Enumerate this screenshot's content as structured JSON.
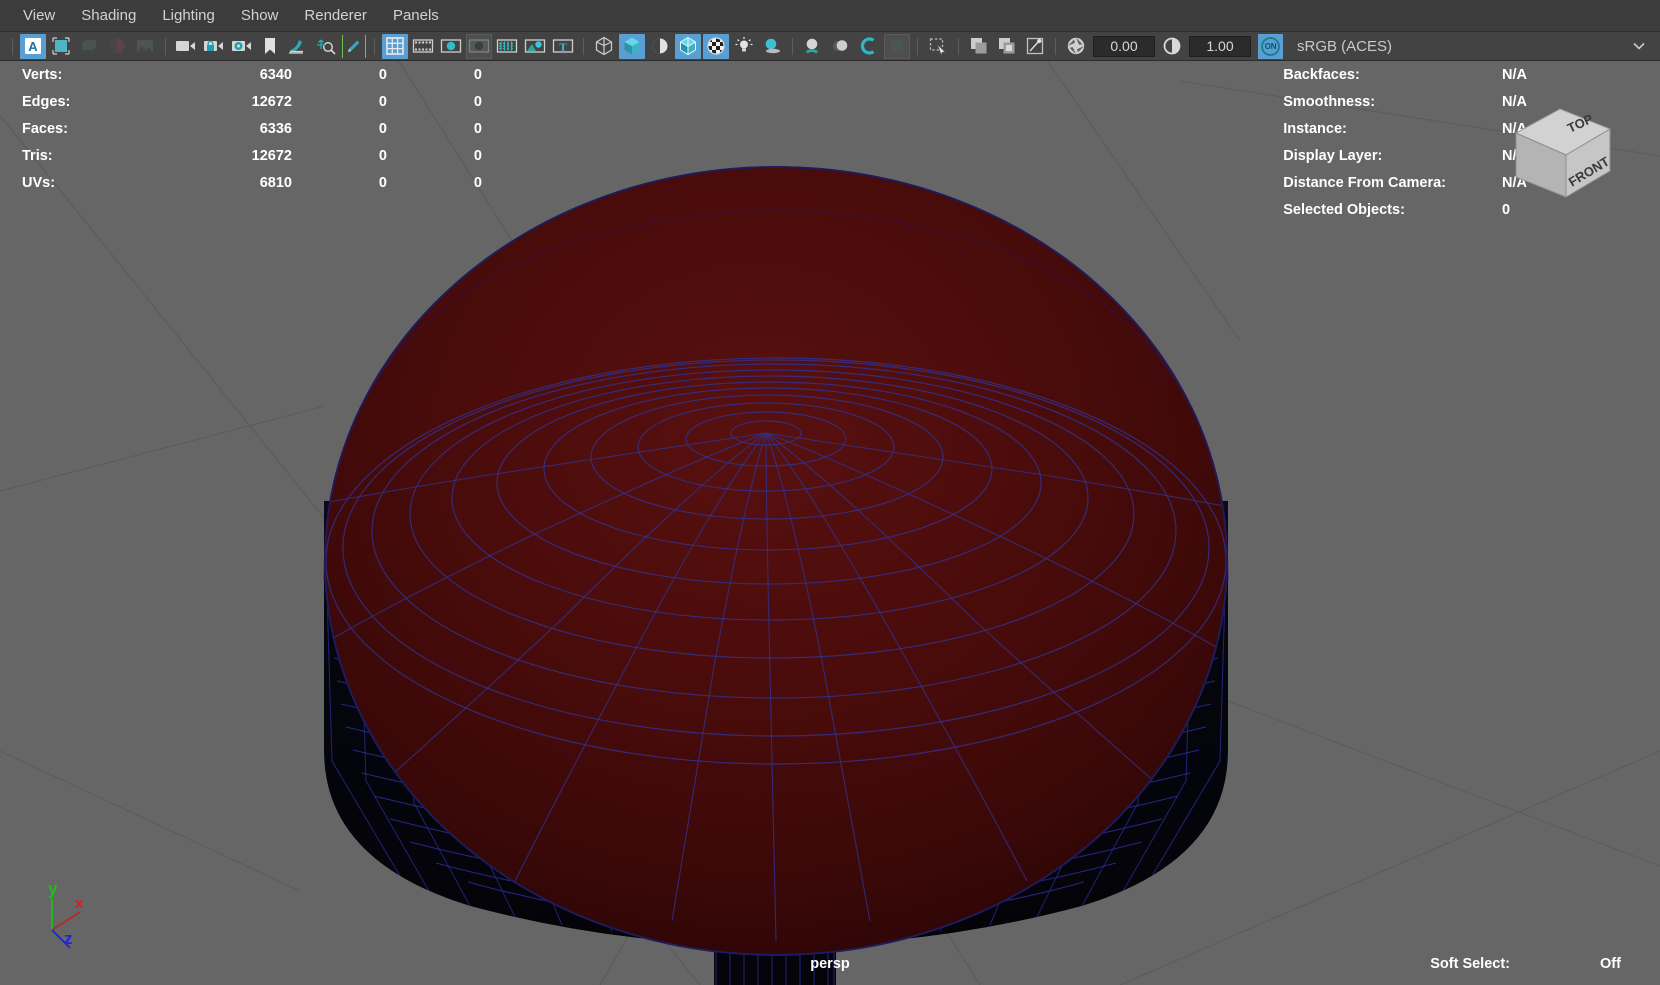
{
  "menu": {
    "items": [
      {
        "label": "View",
        "name": "menu-view"
      },
      {
        "label": "Shading",
        "name": "menu-shading"
      },
      {
        "label": "Lighting",
        "name": "menu-lighting"
      },
      {
        "label": "Show",
        "name": "menu-show"
      },
      {
        "label": "Renderer",
        "name": "menu-renderer"
      },
      {
        "label": "Panels",
        "name": "menu-panels"
      }
    ]
  },
  "toolbar": {
    "exposure_value": "0.00",
    "gamma_value": "1.00",
    "on_toggle_label": "ON",
    "colorspace_value": "sRGB (ACES)",
    "icons": [
      "select-camera-attributes-icon",
      "show-hide-grid-icon",
      "frame-selection-icon",
      "two-sided-lighting-icon",
      "shadows-icon",
      "camera-icon",
      "lock-camera-icon",
      "camera-settings-icon",
      "bookmark-icon",
      "image-plane-icon",
      "reset-view-icon",
      "paint-icon",
      "grid-display-icon",
      "film-gate-icon",
      "resolution-gate-icon",
      "gate-mask-icon",
      "field-chart-icon",
      "safe-action-icon",
      "safe-title-icon",
      "wireframe-icon",
      "smooth-shade-icon",
      "shade-backface-icon",
      "wireframe-on-shaded-icon",
      "texture-icon",
      "use-all-lights-icon",
      "shadows-toggle-icon",
      "screen-space-ao-icon",
      "motion-blur-icon",
      "multisample-icon",
      "depth-of-field-icon",
      "isolate-select-icon",
      "xray-icon",
      "xray-joints-icon",
      "xray-active-components-icon",
      "exposure-icon",
      "gamma-icon",
      "color-management-icon",
      "chevron-down-icon"
    ]
  },
  "stats_left": {
    "columns": [
      "metric",
      "total",
      "col2",
      "col3"
    ],
    "rows": [
      {
        "metric": "Verts:",
        "total": "6340",
        "col2": "0",
        "col3": "0"
      },
      {
        "metric": "Edges:",
        "total": "12672",
        "col2": "0",
        "col3": "0"
      },
      {
        "metric": "Faces:",
        "total": "6336",
        "col2": "0",
        "col3": "0"
      },
      {
        "metric": "Tris:",
        "total": "12672",
        "col2": "0",
        "col3": "0"
      },
      {
        "metric": "UVs:",
        "total": "6810",
        "col2": "0",
        "col3": "0"
      }
    ]
  },
  "stats_right": {
    "rows": [
      {
        "label": "Backfaces:",
        "value": "N/A"
      },
      {
        "label": "Smoothness:",
        "value": "N/A"
      },
      {
        "label": "Instance:",
        "value": "N/A"
      },
      {
        "label": "Display Layer:",
        "value": "N/A"
      },
      {
        "label": "Distance From Camera:",
        "value": "N/A"
      },
      {
        "label": "Selected Objects:",
        "value": "0"
      }
    ]
  },
  "viewcube": {
    "top_face": "TOP",
    "front_face": "FRONT"
  },
  "axis_gizmo": {
    "x_label": "x",
    "y_label": "y",
    "z_label": "z",
    "x_color": "#d42020",
    "y_color": "#18c018",
    "z_color": "#1d25e0"
  },
  "viewport": {
    "camera_label": "persp",
    "soft_select_label": "Soft Select:",
    "soft_select_value": "Off",
    "background_color": "#666666",
    "model_surface_color": "#4a0b0b",
    "model_wire_color": "#2f2f8c",
    "model_body_color": "#050510"
  }
}
